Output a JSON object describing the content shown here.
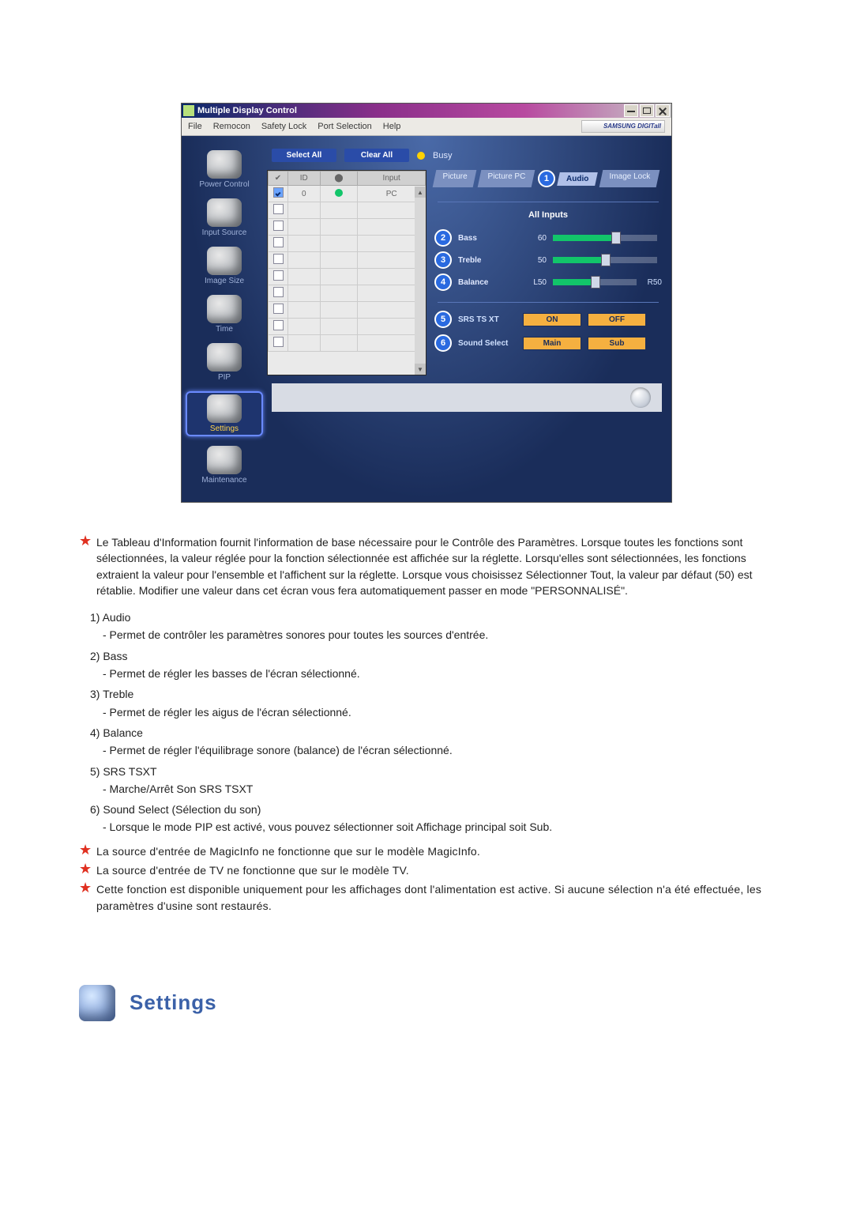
{
  "window": {
    "title": "Multiple Display Control",
    "menu": [
      "File",
      "Remocon",
      "Safety Lock",
      "Port Selection",
      "Help"
    ],
    "brand": "SAMSUNG DIGITall"
  },
  "sidebar": [
    {
      "label": "Power Control",
      "active": false
    },
    {
      "label": "Input Source",
      "active": false
    },
    {
      "label": "Image Size",
      "active": false
    },
    {
      "label": "Time",
      "active": false
    },
    {
      "label": "PIP",
      "active": false
    },
    {
      "label": "Settings",
      "active": true
    },
    {
      "label": "Maintenance",
      "active": false
    }
  ],
  "top": {
    "selectAll": "Select All",
    "clearAll": "Clear All",
    "busy": "Busy"
  },
  "grid": {
    "headers": [
      "",
      "ID",
      "",
      "Input"
    ],
    "rows": [
      {
        "checked": true,
        "id": "0",
        "status": "green",
        "input": "PC"
      },
      {
        "checked": false,
        "id": "",
        "status": "",
        "input": ""
      },
      {
        "checked": false,
        "id": "",
        "status": "",
        "input": ""
      },
      {
        "checked": false,
        "id": "",
        "status": "",
        "input": ""
      },
      {
        "checked": false,
        "id": "",
        "status": "",
        "input": ""
      },
      {
        "checked": false,
        "id": "",
        "status": "",
        "input": ""
      },
      {
        "checked": false,
        "id": "",
        "status": "",
        "input": ""
      },
      {
        "checked": false,
        "id": "",
        "status": "",
        "input": ""
      },
      {
        "checked": false,
        "id": "",
        "status": "",
        "input": ""
      },
      {
        "checked": false,
        "id": "",
        "status": "",
        "input": ""
      }
    ]
  },
  "tabs": {
    "items": [
      {
        "label": "Picture",
        "active": false
      },
      {
        "label": "Picture PC",
        "active": false
      },
      {
        "label": "Audio",
        "active": true,
        "callout": "1"
      },
      {
        "label": "Image Lock",
        "active": false
      }
    ],
    "section": "All Inputs"
  },
  "sliders": [
    {
      "callout": "2",
      "label": "Bass",
      "value": "60",
      "class": "v60",
      "left": "",
      "right": ""
    },
    {
      "callout": "3",
      "label": "Treble",
      "value": "50",
      "class": "v50",
      "left": "",
      "right": ""
    },
    {
      "callout": "4",
      "label": "Balance",
      "value": "L50",
      "class": "v50",
      "left": "",
      "right": "R50"
    }
  ],
  "toggles": [
    {
      "callout": "5",
      "label": "SRS TS XT",
      "opts": [
        "ON",
        "OFF"
      ]
    },
    {
      "callout": "6",
      "label": "Sound Select",
      "opts": [
        "Main",
        "Sub"
      ]
    }
  ],
  "doc": {
    "intro": "Le Tableau d'Information fournit l'information de base nécessaire pour le Contrôle des Paramètres. Lorsque toutes les fonctions sont sélectionnées, la valeur réglée pour la fonction sélectionnée est affichée sur la réglette. Lorsqu'elles sont sélectionnées, les fonctions extraient la valeur pour l'ensemble et l'affichent sur la réglette. Lorsque vous choisissez Sélectionner Tout, la valeur par défaut (50) est rétablie. Modifier une valeur dans cet écran vous fera automatiquement passer en mode \"PERSONNALISÉ\".",
    "items": [
      {
        "n": "1)",
        "title": "Audio",
        "desc": "- Permet de contrôler les paramètres sonores pour toutes les sources d'entrée."
      },
      {
        "n": "2)",
        "title": "Bass",
        "desc": "- Permet de régler les basses de l'écran sélectionné."
      },
      {
        "n": "3)",
        "title": "Treble",
        "desc": "- Permet de régler les aigus de l'écran sélectionné."
      },
      {
        "n": "4)",
        "title": "Balance",
        "desc": "- Permet de régler l'équilibrage sonore (balance) de l'écran sélectionné."
      },
      {
        "n": "5)",
        "title": "SRS TSXT",
        "desc": "- Marche/Arrêt Son SRS TSXT"
      },
      {
        "n": "6)",
        "title": "Sound Select (Sélection du son)",
        "desc": "- Lorsque le mode PIP est activé, vous pouvez sélectionner soit Affichage principal soit Sub."
      }
    ],
    "notes": [
      "La source d'entrée de MagicInfo ne fonctionne que sur le modèle MagicInfo.",
      "La source d'entrée de TV ne fonctionne que sur le modèle TV.",
      "Cette fonction est disponible uniquement pour les affichages dont l'alimentation est active. Si aucune sélection n'a été effectuée, les paramètres d'usine sont restaurés."
    ],
    "heading": "Settings"
  }
}
